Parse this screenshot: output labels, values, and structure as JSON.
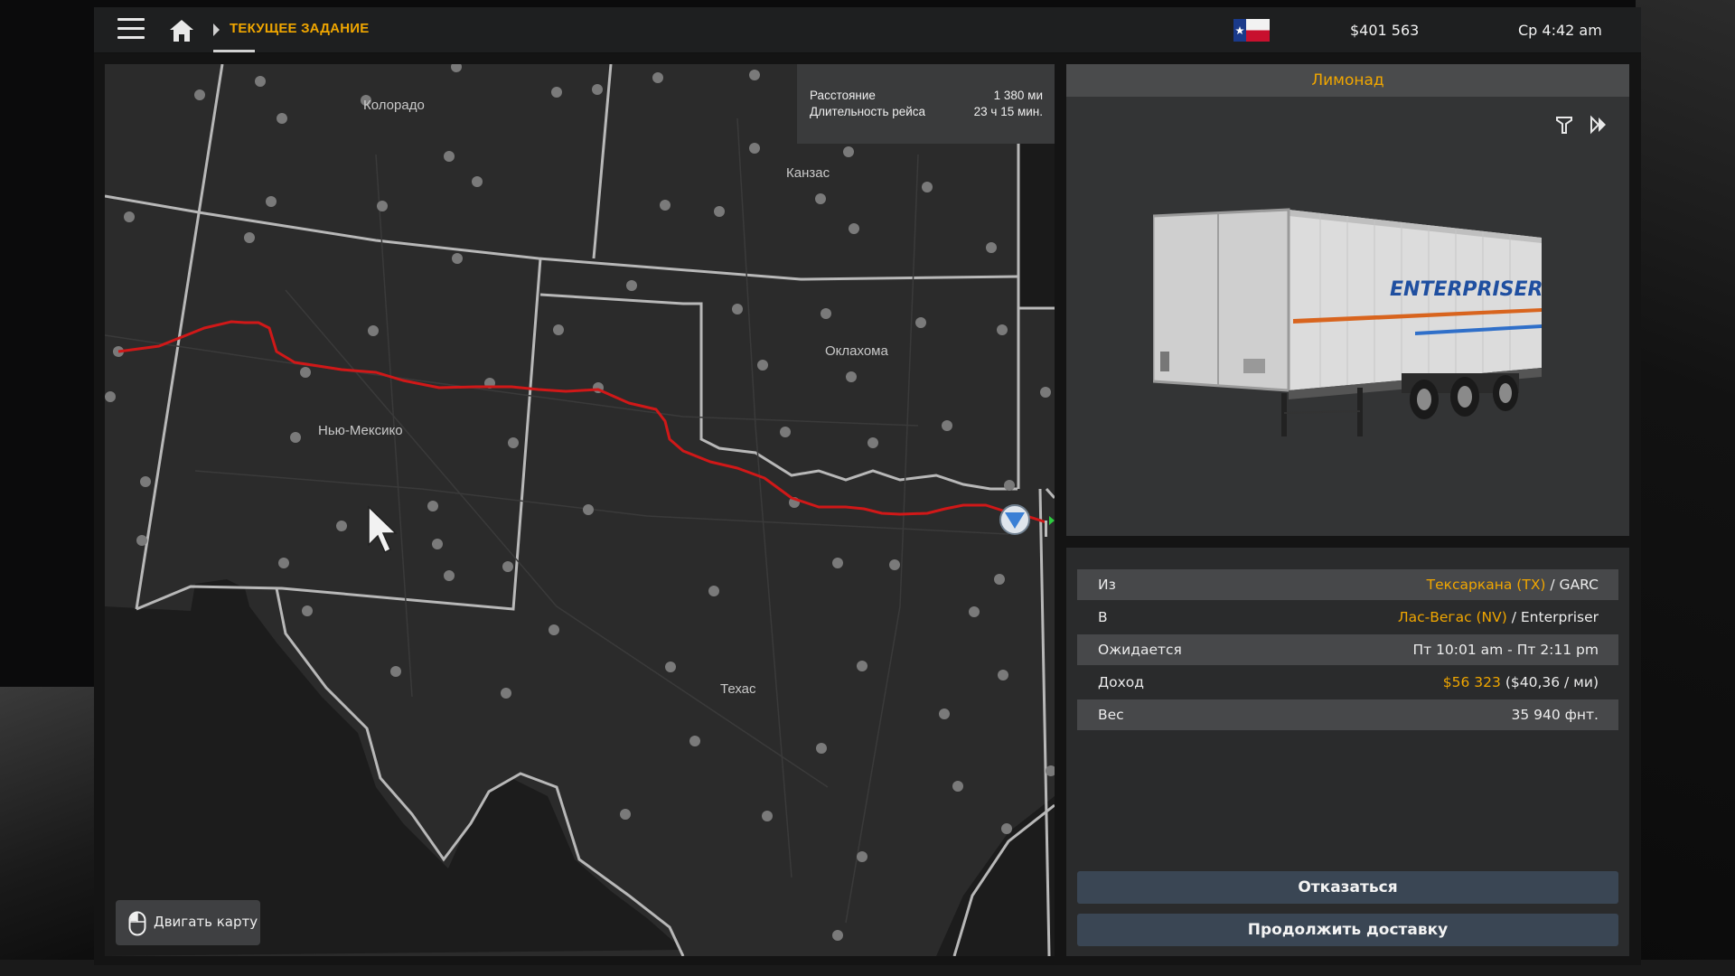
{
  "topbar": {
    "breadcrumb": "ТЕКУЩЕЕ ЗАДАНИЕ",
    "money": "$401 563",
    "time": "Ср 4:42 am"
  },
  "map": {
    "labels": {
      "colorado": "Колорадо",
      "kansas": "Канзас",
      "oklahoma": "Оклахома",
      "new_mexico": "Нью-Мексико",
      "texas": "Техас"
    },
    "info": {
      "distance_label": "Расстояние",
      "distance_value": "1 380 ми",
      "duration_label": "Длительность рейса",
      "duration_value": "23 ч 15 мин."
    },
    "move_button": "Двигать карту"
  },
  "cargo": {
    "title": "Лимонад",
    "trailer_brand": "ENTERPRISER"
  },
  "details": {
    "from_label": "Из",
    "from_city": "Тексаркана (TX)",
    "from_company": " / GARC",
    "to_label": "В",
    "to_city": "Лас-Вегас (NV)",
    "to_company": " / Enterpriser",
    "expected_label": "Ожидается",
    "expected_value": "Пт 10:01 am - Пт 2:11 pm",
    "income_label": "Доход",
    "income_value": "$56 323",
    "income_rate": " ($40,36 / ми)",
    "weight_label": "Вес",
    "weight_value": "35 940 фнт."
  },
  "buttons": {
    "decline": "Отказаться",
    "continue": "Продолжить доставку"
  },
  "colors": {
    "accent": "#f0a600",
    "route": "#d01818",
    "button_bg": "#3a4654"
  },
  "icons": {
    "menu": "hamburger-menu-icon",
    "home": "home-icon",
    "flag": "texas-flag-icon",
    "mouse": "mouse-icon",
    "filter": "cargo-filter-icon",
    "skip": "skip-forward-icon",
    "cursor": "mouse-pointer-icon"
  }
}
